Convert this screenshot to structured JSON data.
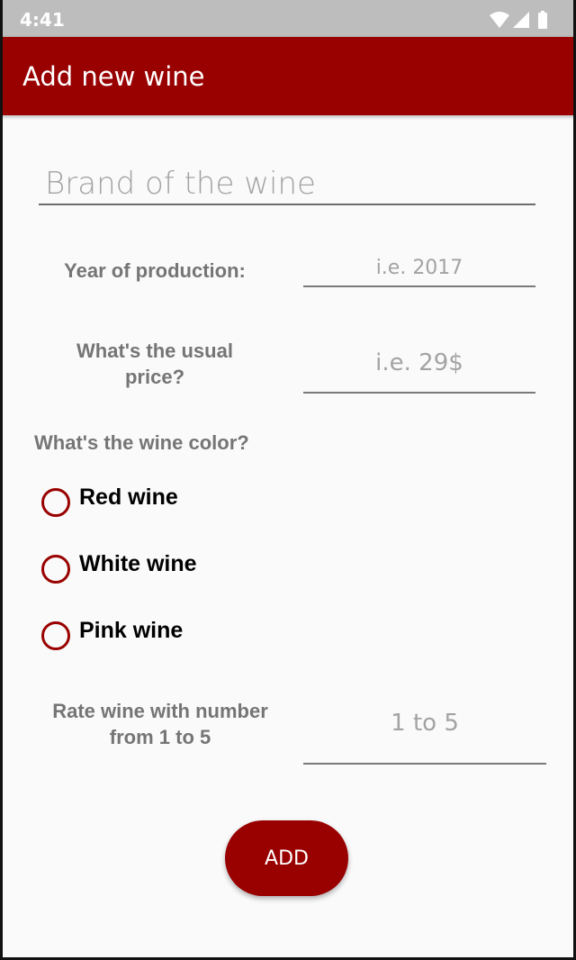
{
  "status_bar": {
    "time": "4:41",
    "icons": [
      "wifi-icon",
      "signal-icon",
      "battery-icon"
    ]
  },
  "app_bar": {
    "title": "Add new wine"
  },
  "form": {
    "brand": {
      "placeholder": "Brand of the wine"
    },
    "year": {
      "label": "Year of production:",
      "placeholder": "i.e. 2017"
    },
    "price": {
      "label_line1": "What's the usual",
      "label_line2": "price?",
      "placeholder": "i.e. 29$"
    },
    "color": {
      "question": "What's the wine color?",
      "options": [
        {
          "label": "Red wine",
          "checked": false
        },
        {
          "label": "White wine",
          "checked": false
        },
        {
          "label": "Pink wine",
          "checked": false
        }
      ]
    },
    "rating": {
      "label_line1": "Rate wine with number",
      "label_line2": "from 1 to 5",
      "placeholder": "1 to 5"
    },
    "submit_label": "ADD"
  },
  "colors": {
    "accent": "#990000",
    "status_bar": "#bdbdbd",
    "background": "#fafafa",
    "label_text": "#757575",
    "hint_text": "#a3a3a3"
  }
}
